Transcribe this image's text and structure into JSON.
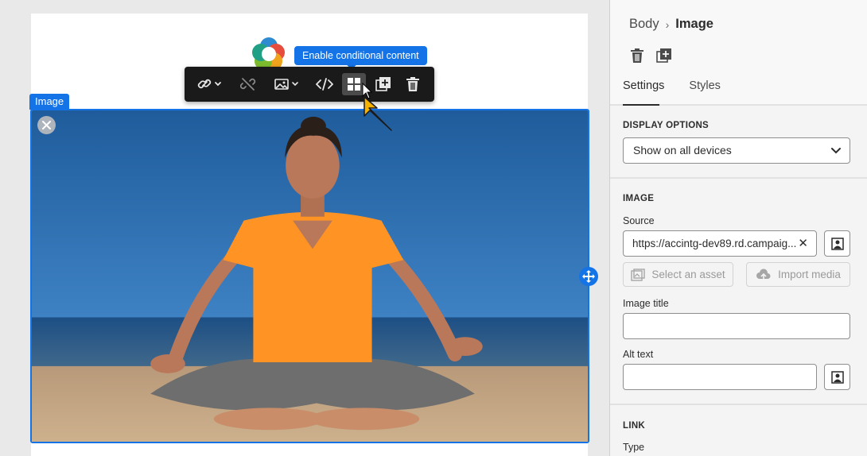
{
  "canvas": {
    "tooltip": "Enable conditional content",
    "block_label": "Image",
    "toolbar": {
      "buttons": [
        "link-icon",
        "unlink-icon",
        "image-icon",
        "code-icon",
        "conditional-content-icon",
        "duplicate-icon",
        "delete-icon"
      ],
      "active_button": "conditional-content-icon"
    },
    "colors": {
      "accent": "#1473e6",
      "toolbar_bg": "#1a1a1a",
      "arrow": "#f5b300"
    }
  },
  "panel": {
    "breadcrumb": {
      "root": "Body",
      "separator": "›",
      "current": "Image"
    },
    "header_actions": [
      "delete-icon",
      "duplicate-icon"
    ],
    "tabs": [
      {
        "label": "Settings",
        "selected": true
      },
      {
        "label": "Styles",
        "selected": false
      }
    ],
    "display_options": {
      "title": "DISPLAY OPTIONS",
      "selected": "Show on all devices"
    },
    "image": {
      "title": "IMAGE",
      "source_label": "Source",
      "source_value": "https://accintg-dev89.rd.campaig...",
      "select_asset_label": "Select an asset",
      "import_media_label": "Import media",
      "image_title_label": "Image title",
      "image_title_value": "",
      "alt_text_label": "Alt text",
      "alt_text_value": ""
    },
    "link": {
      "title": "LINK",
      "type_label": "Type"
    }
  }
}
